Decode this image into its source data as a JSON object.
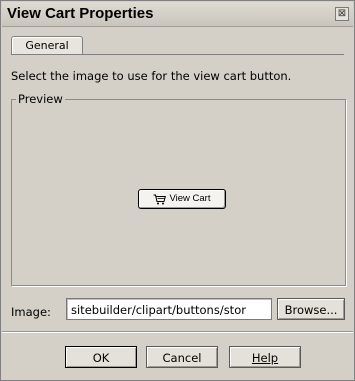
{
  "window": {
    "title": "View Cart Properties",
    "close_icon": "close-icon"
  },
  "tabs": [
    {
      "label": "General",
      "selected": true
    }
  ],
  "instruction": "Select the image to use for the view cart button.",
  "preview": {
    "legend": "Preview",
    "button_label": "View Cart",
    "button_icon": "shopping-cart-icon"
  },
  "image": {
    "label": "Image:",
    "value": "sitebuilder/clipart/buttons/stor",
    "browse_label": "Browse..."
  },
  "footer": {
    "ok_label": "OK",
    "cancel_label": "Cancel",
    "help_label": "Help"
  }
}
